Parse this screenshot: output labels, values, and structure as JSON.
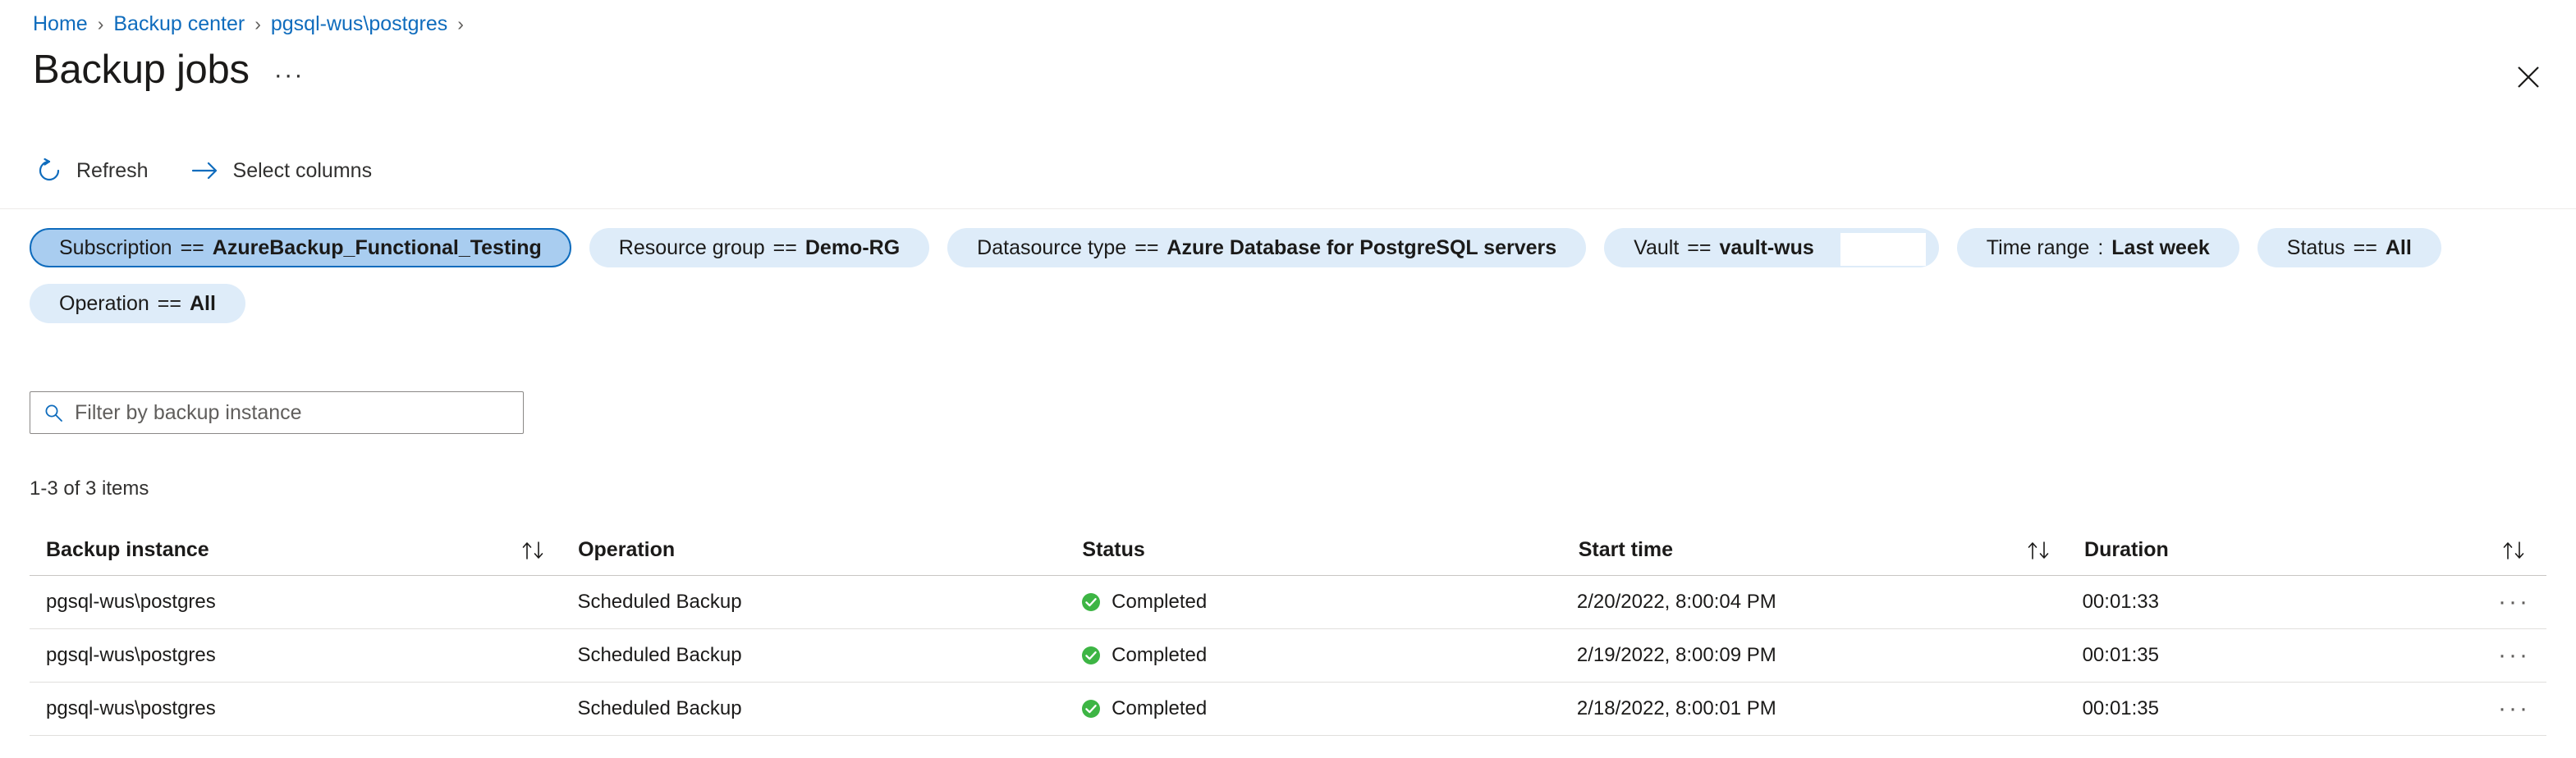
{
  "breadcrumb": {
    "items": [
      {
        "label": "Home"
      },
      {
        "label": "Backup center"
      },
      {
        "label": "pgsql-wus\\postgres"
      }
    ],
    "separator": "›"
  },
  "header": {
    "title": "Backup jobs",
    "ellipsis": "···",
    "close_icon": "close-icon"
  },
  "toolbar": {
    "refresh_label": "Refresh",
    "refresh_icon": "refresh-icon",
    "select_columns_label": "Select columns",
    "select_columns_icon": "arrow-right-icon"
  },
  "filters": [
    {
      "key": "Subscription",
      "op": "==",
      "value": "AzureBackup_Functional_Testing",
      "selected": true,
      "whitebox": false
    },
    {
      "key": "Resource group",
      "op": "==",
      "value": "Demo-RG",
      "selected": false,
      "whitebox": false
    },
    {
      "key": "Datasource type",
      "op": "==",
      "value": "Azure Database for PostgreSQL servers",
      "selected": false,
      "whitebox": false
    },
    {
      "key": "Vault",
      "op": "==",
      "value": "vault-wus",
      "selected": false,
      "whitebox": true
    },
    {
      "key": "Time range",
      "op": ":",
      "value": "Last week",
      "selected": false,
      "whitebox": false
    },
    {
      "key": "Status",
      "op": "==",
      "value": "All",
      "selected": false,
      "whitebox": false
    },
    {
      "key": "Operation",
      "op": "==",
      "value": "All",
      "selected": false,
      "whitebox": false
    }
  ],
  "search": {
    "placeholder": "Filter by backup instance",
    "value": "",
    "icon": "search-icon"
  },
  "results": {
    "count_text": "1-3 of 3 items"
  },
  "table": {
    "columns": {
      "instance": "Backup instance",
      "operation": "Operation",
      "status": "Status",
      "start_time": "Start time",
      "duration": "Duration"
    },
    "sort_icon": "sort-ascending-descending-icon",
    "row_menu_icon": "more-actions-icon",
    "status_icon": "success-check-circle-icon",
    "rows": [
      {
        "instance": "pgsql-wus\\postgres",
        "operation": "Scheduled Backup",
        "status": "Completed",
        "start_time": "2/20/2022, 8:00:04 PM",
        "duration": "00:01:33",
        "menu": "···"
      },
      {
        "instance": "pgsql-wus\\postgres",
        "operation": "Scheduled Backup",
        "status": "Completed",
        "start_time": "2/19/2022, 8:00:09 PM",
        "duration": "00:01:35",
        "menu": "···"
      },
      {
        "instance": "pgsql-wus\\postgres",
        "operation": "Scheduled Backup",
        "status": "Completed",
        "start_time": "2/18/2022, 8:00:01 PM",
        "duration": "00:01:35",
        "menu": "···"
      }
    ]
  },
  "colors": {
    "link": "#0f6cbd",
    "pill_bg": "#deecf9",
    "pill_selected_bg": "#a9cdf0",
    "success_green": "#3db544",
    "text": "#1b1a19"
  }
}
